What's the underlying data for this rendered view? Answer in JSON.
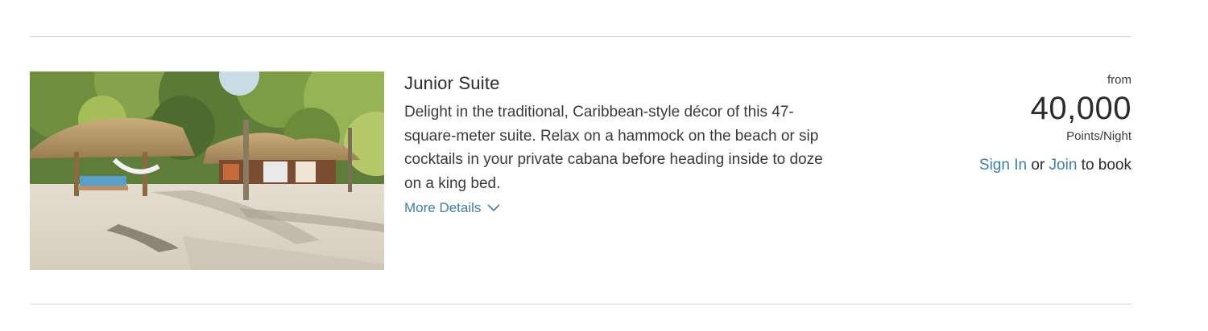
{
  "room": {
    "title": "Junior Suite",
    "description": "Delight in the traditional, Caribbean-style décor of this 47-square-meter suite. Relax on a hammock on the beach or sip cocktails in your private cabana before heading inside to doze on a king bed.",
    "more_details_label": "More Details",
    "photo_icon": "beach-cabana-photo"
  },
  "price": {
    "from_label": "from",
    "amount": "40,000",
    "unit": "Points/Night"
  },
  "booking": {
    "sign_in_label": "Sign In",
    "or_text": "or",
    "join_label": "Join",
    "to_book_text": "to book"
  },
  "colors": {
    "link": "#3f7fa6",
    "text": "#2b2b2b",
    "divider": "#d7d7d7"
  }
}
